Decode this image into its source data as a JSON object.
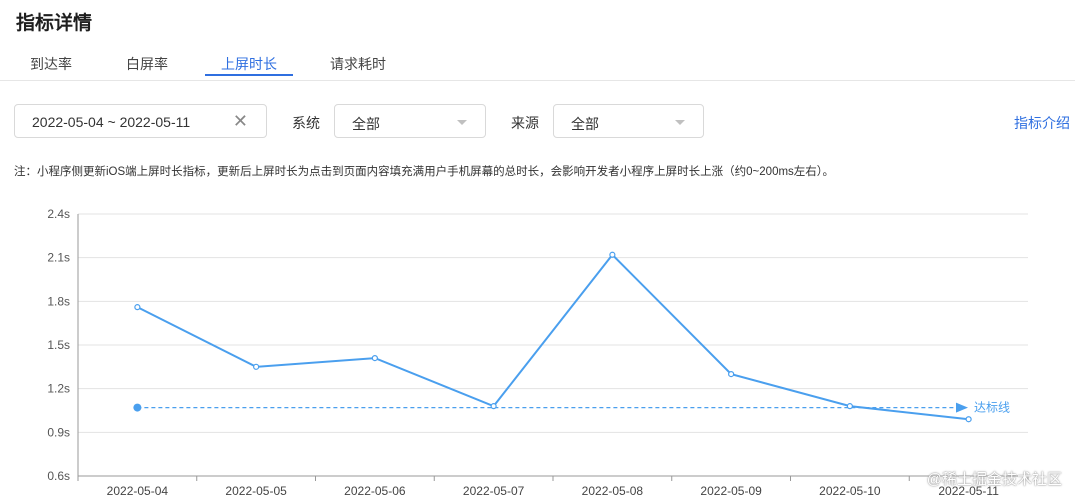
{
  "page_title": "指标详情",
  "tabs": [
    {
      "label": "到达率"
    },
    {
      "label": "白屏率"
    },
    {
      "label": "上屏时长"
    },
    {
      "label": "请求耗时"
    }
  ],
  "filters": {
    "date_range": "2022-05-04 ~ 2022-05-11",
    "system_label": "系统",
    "system_value": "全部",
    "source_label": "来源",
    "source_value": "全部"
  },
  "intro_link": "指标介绍",
  "note": "注：小程序侧更新iOS端上屏时长指标，更新后上屏时长为点击到页面内容填充满用户手机屏幕的总时长，会影响开发者小程序上屏时长上涨（约0~200ms左右）。",
  "watermark": "@稀土掘金技术社区",
  "colors": {
    "accent": "#2f6fe0",
    "line": "#4a9fee",
    "grid": "#e3e3e3"
  },
  "chart_data": {
    "type": "line",
    "categories": [
      "2022-05-04",
      "2022-05-05",
      "2022-05-06",
      "2022-05-07",
      "2022-05-08",
      "2022-05-09",
      "2022-05-10",
      "2022-05-11"
    ],
    "series": [
      {
        "values": [
          1.76,
          1.35,
          1.41,
          1.08,
          2.12,
          1.3,
          1.08,
          0.99
        ]
      }
    ],
    "threshold": {
      "value": 1.07,
      "label": "达标线"
    },
    "yticks": [
      "2.4s",
      "2.1s",
      "1.8s",
      "1.5s",
      "1.2s",
      "0.9s",
      "0.6s"
    ],
    "ylim": [
      0.6,
      2.4
    ],
    "grid": true
  }
}
